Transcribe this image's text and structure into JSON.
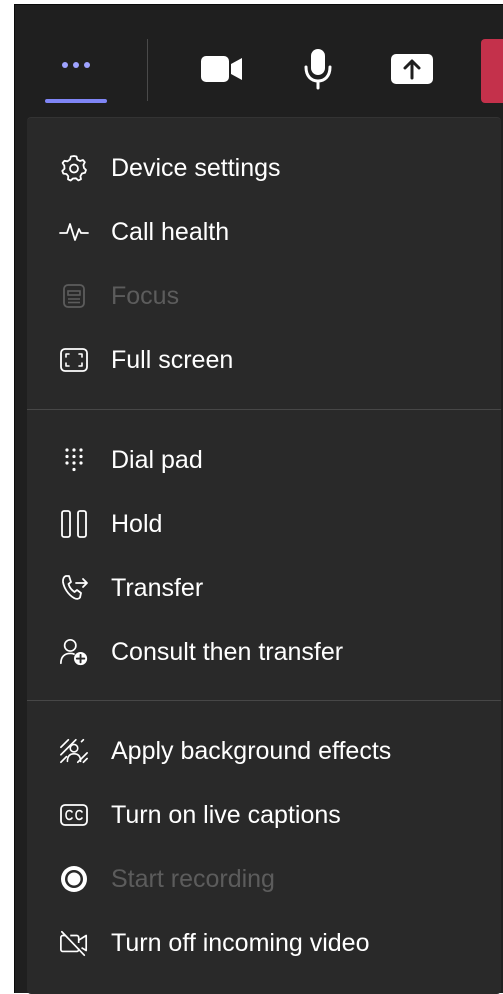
{
  "toolbar": {
    "buttons": [
      {
        "icon": "more-options-icon",
        "active": true
      },
      {
        "icon": "camera-icon"
      },
      {
        "icon": "microphone-icon"
      },
      {
        "icon": "share-screen-icon"
      },
      {
        "icon": "hang-up-icon"
      }
    ],
    "accent_color": "#7f85f5",
    "hangup_color": "#c4314b"
  },
  "menu": {
    "groups": [
      {
        "items": [
          {
            "label": "Device settings",
            "icon": "gear-icon",
            "enabled": true
          },
          {
            "label": "Call health",
            "icon": "pulse-icon",
            "enabled": true
          },
          {
            "label": "Focus",
            "icon": "focus-icon",
            "enabled": false
          },
          {
            "label": "Full screen",
            "icon": "full-screen-icon",
            "enabled": true
          }
        ]
      },
      {
        "items": [
          {
            "label": "Dial pad",
            "icon": "dial-pad-icon",
            "enabled": true
          },
          {
            "label": "Hold",
            "icon": "pause-icon",
            "enabled": true
          },
          {
            "label": "Transfer",
            "icon": "transfer-icon",
            "enabled": true
          },
          {
            "label": "Consult then transfer",
            "icon": "consult-transfer-icon",
            "enabled": true
          }
        ]
      },
      {
        "items": [
          {
            "label": "Apply background effects",
            "icon": "background-effects-icon",
            "enabled": true
          },
          {
            "label": "Turn on live captions",
            "icon": "closed-captions-icon",
            "enabled": true
          },
          {
            "label": "Start recording",
            "icon": "record-icon",
            "enabled": false
          },
          {
            "label": "Turn off incoming video",
            "icon": "video-off-icon",
            "enabled": true
          }
        ]
      }
    ]
  }
}
